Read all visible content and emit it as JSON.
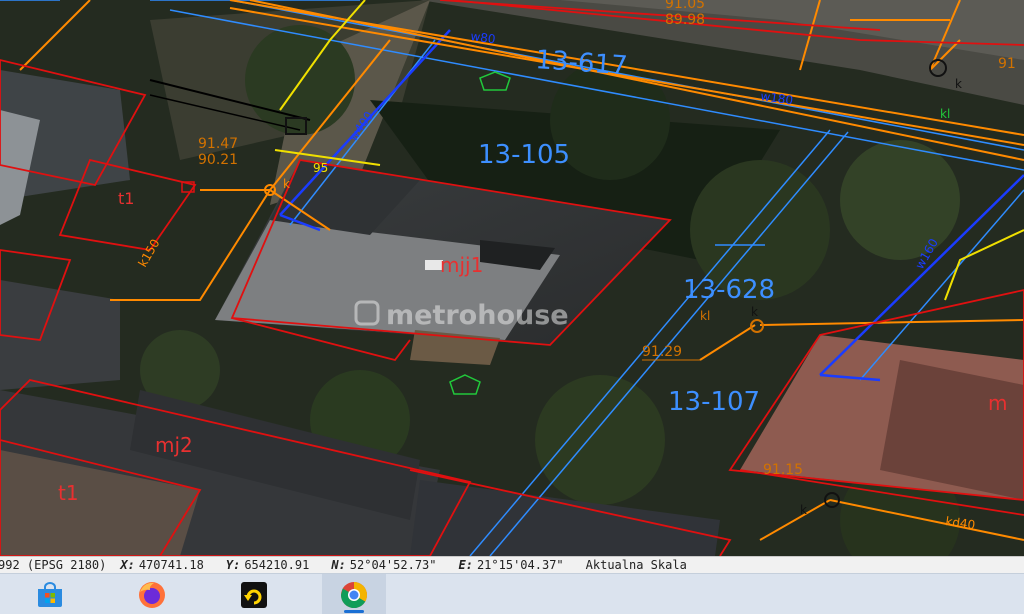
{
  "map": {
    "parcels": [
      "13-617",
      "13-105",
      "13-628",
      "13-107"
    ],
    "building_labels": [
      "mjj1",
      "mj2",
      "t1",
      "t1",
      "m"
    ],
    "utility_labels": [
      "k",
      "kl",
      "k",
      "k",
      "k",
      "kl",
      "95",
      "w80",
      "w400",
      "w160",
      "w180",
      "k150",
      "kd40"
    ],
    "elevations": [
      "91.47",
      "90.21",
      "91.29",
      "91.15",
      "91.05",
      "89.98",
      "91"
    ],
    "watermark": "metrohouse",
    "colors": {
      "parcel_boundary": "#2f8cff",
      "building_outline": "#e01010",
      "sewer_line": "#ff8a00",
      "water_line": "#1a3cff",
      "gas_line": "#f0e000",
      "tree_symbol": "#21c83b",
      "parcel_label": "#3d8fff",
      "building_label": "#e83030"
    }
  },
  "statusbar": {
    "crs": "992 (EPSG 2180)",
    "x_label": "X:",
    "x_value": "470741.18",
    "y_label": "Y:",
    "y_value": "654210.91",
    "n_label": "N:",
    "n_value": "52°04'52.73\"",
    "e_label": "E:",
    "e_value": "21°15'04.37\"",
    "scale_label": "Aktualna Skala"
  },
  "taskbar": {
    "apps": [
      {
        "name": "microsoft-store",
        "icon": "store-icon",
        "active": false
      },
      {
        "name": "firefox",
        "icon": "firefox-icon",
        "active": false
      },
      {
        "name": "rotate-app",
        "icon": "rotate-arrow-icon",
        "active": false
      },
      {
        "name": "chrome",
        "icon": "chrome-icon",
        "active": true
      }
    ]
  }
}
